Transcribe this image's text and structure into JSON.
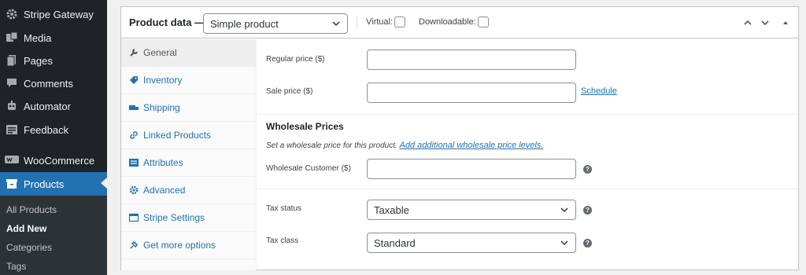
{
  "sidebar": {
    "items": [
      {
        "label": "Stripe Gateway",
        "icon": "gear-icon"
      },
      {
        "label": "Media",
        "icon": "media-icon"
      },
      {
        "label": "Pages",
        "icon": "pages-icon"
      },
      {
        "label": "Comments",
        "icon": "comments-icon"
      },
      {
        "label": "Automator",
        "icon": "automator-icon"
      },
      {
        "label": "Feedback",
        "icon": "feedback-icon"
      },
      {
        "label": "WooCommerce",
        "icon": "woocommerce-icon"
      },
      {
        "label": "Products",
        "icon": "products-icon"
      }
    ],
    "submenu": [
      "All Products",
      "Add New",
      "Categories",
      "Tags"
    ]
  },
  "panel": {
    "title": "Product data —",
    "product_type": "Simple product",
    "virtual_label": "Virtual:",
    "downloadable_label": "Downloadable:"
  },
  "tabs": [
    {
      "label": "General",
      "icon": "wrench-icon"
    },
    {
      "label": "Inventory",
      "icon": "tag-icon"
    },
    {
      "label": "Shipping",
      "icon": "truck-icon"
    },
    {
      "label": "Linked Products",
      "icon": "link-icon"
    },
    {
      "label": "Attributes",
      "icon": "list-icon"
    },
    {
      "label": "Advanced",
      "icon": "gear-icon"
    },
    {
      "label": "Stripe Settings",
      "icon": "window-icon"
    },
    {
      "label": "Get more options",
      "icon": "plugin-icon"
    }
  ],
  "general": {
    "regular_price_label": "Regular price ($)",
    "regular_price_value": "",
    "sale_price_label": "Sale price ($)",
    "sale_price_value": "",
    "schedule_link": "Schedule",
    "wholesale_title": "Wholesale Prices",
    "wholesale_desc": "Set a wholesale price for this product.",
    "wholesale_link": "Add additional wholesale price levels.",
    "wholesale_customer_label": "Wholesale Customer ($)",
    "wholesale_customer_value": "",
    "tax_status_label": "Tax status",
    "tax_status_value": "Taxable",
    "tax_class_label": "Tax class",
    "tax_class_value": "Standard"
  },
  "colors": {
    "accent": "#2271b1",
    "sidebar_bg": "#1d2327"
  }
}
